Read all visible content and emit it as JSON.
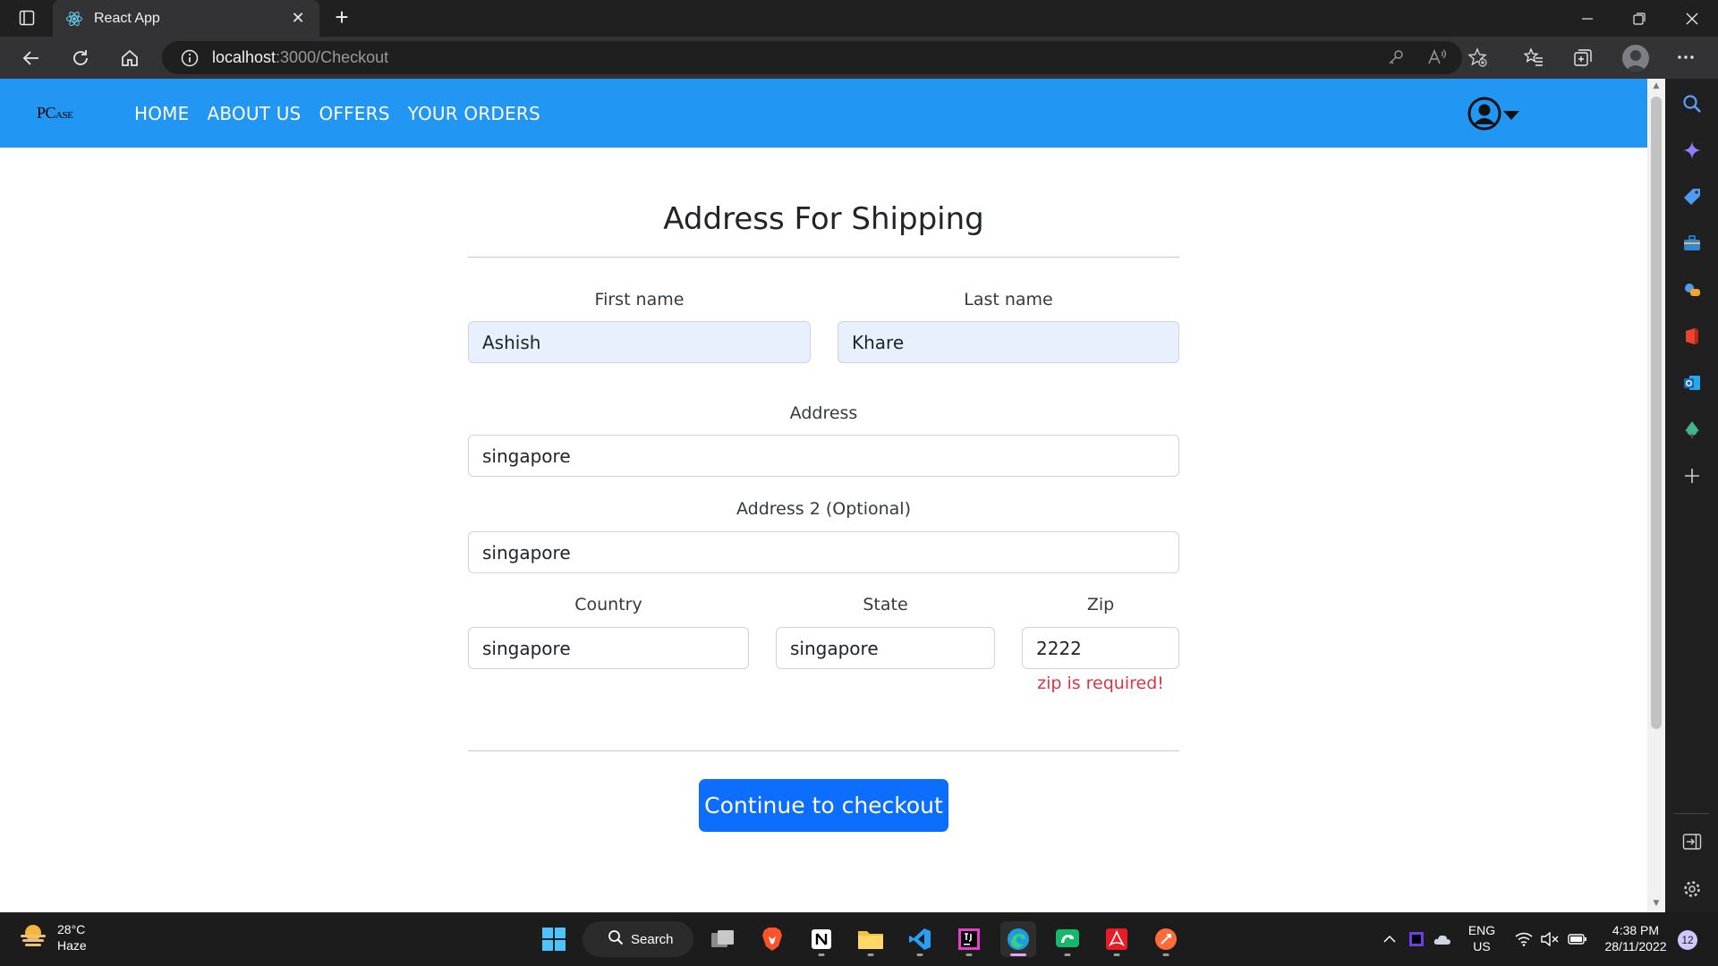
{
  "browser": {
    "tab_title": "React App",
    "url_host": "localhost",
    "url_rest": ":3000/Checkout",
    "new_tab_symbol": "+",
    "close_symbol": "✕"
  },
  "app": {
    "brand_main": "PC",
    "brand_small": "ASE",
    "nav": [
      "HOME",
      "ABOUT US",
      "OFFERS",
      "YOUR ORDERS"
    ]
  },
  "form": {
    "title": "Address For Shipping",
    "first_name": {
      "label": "First name",
      "value": "Ashish"
    },
    "last_name": {
      "label": "Last name",
      "value": "Khare"
    },
    "address": {
      "label": "Address",
      "value": "singapore"
    },
    "address2": {
      "label": "Address 2 (Optional)",
      "value": "singapore"
    },
    "country": {
      "label": "Country",
      "value": "singapore"
    },
    "state": {
      "label": "State",
      "value": "singapore"
    },
    "zip": {
      "label": "Zip",
      "value": "2222",
      "error": "zip is required!"
    },
    "submit_label": "Continue to checkout"
  },
  "taskbar": {
    "weather_temp": "28°C",
    "weather_desc": "Haze",
    "search_label": "Search",
    "lang_top": "ENG",
    "lang_bottom": "US",
    "time": "4:38 PM",
    "date": "28/11/2022",
    "notification_count": "12"
  },
  "colors": {
    "navbar": "#2196f3",
    "primary_button": "#0d6efd",
    "error": "#dc3545",
    "autofill": "#e8f0fe"
  }
}
